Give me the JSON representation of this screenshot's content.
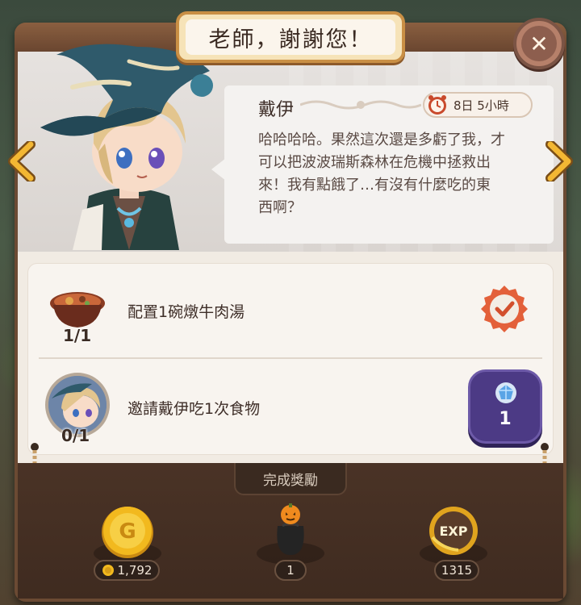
{
  "dialog": {
    "title": "老師，謝謝您！",
    "npc_name": "戴伊",
    "timer_text": "8日 5小時",
    "message": "哈哈哈哈。果然這次還是多虧了我，才\n可以把波波瑞斯森林在危機中拯救出\n來！我有點餓了…有沒有什麼吃的東\n西啊？"
  },
  "tasks": [
    {
      "label": "配置1碗燉牛肉湯",
      "count": "1/1",
      "icon": "beef-stew-icon",
      "status": "completed"
    },
    {
      "label": "邀請戴伊吃1次食物",
      "count": "0/1",
      "icon": "dai-avatar",
      "reward_icon": "crystal-gem-icon",
      "reward_value": "1"
    }
  ],
  "rewards": {
    "section_label": "完成獎勵",
    "items": [
      {
        "icon": "gold-coin-icon",
        "value": "1,792"
      },
      {
        "icon": "pumpkin-bag-icon",
        "value": "1"
      },
      {
        "icon": "exp-icon",
        "value": "1315"
      }
    ]
  },
  "colors": {
    "frame": "#4f3424",
    "title_border": "#c98f45",
    "check_badge": "#e3603a",
    "reward_button": "#4c3a85",
    "gold": "#f2b91e"
  }
}
